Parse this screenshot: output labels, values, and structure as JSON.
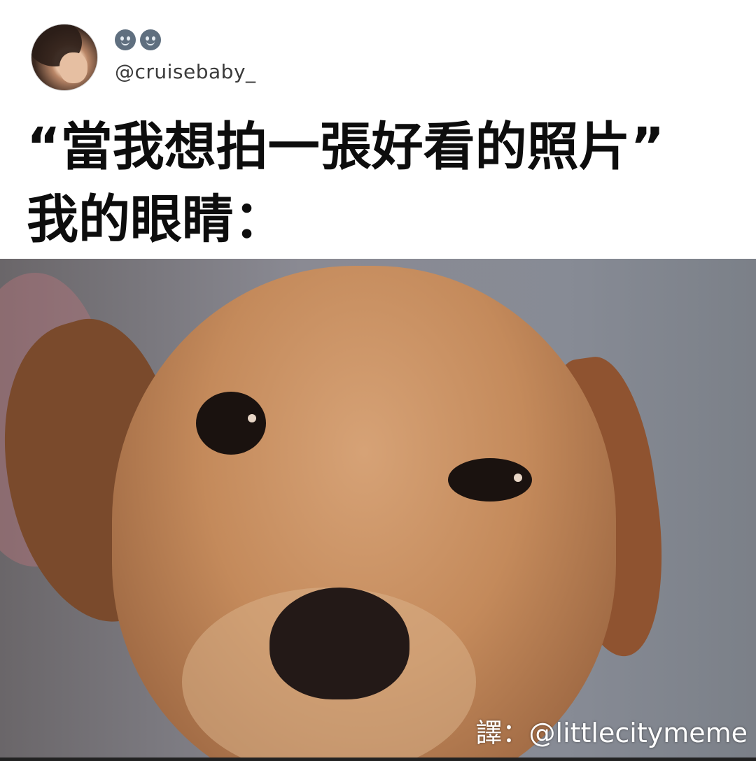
{
  "post": {
    "handle": "@cruisebaby_",
    "caption_lines": [
      "“當我想拍一張好看的照片”",
      "我的眼睛："
    ]
  },
  "image": {
    "credit": "譯：@littlecitymeme"
  }
}
